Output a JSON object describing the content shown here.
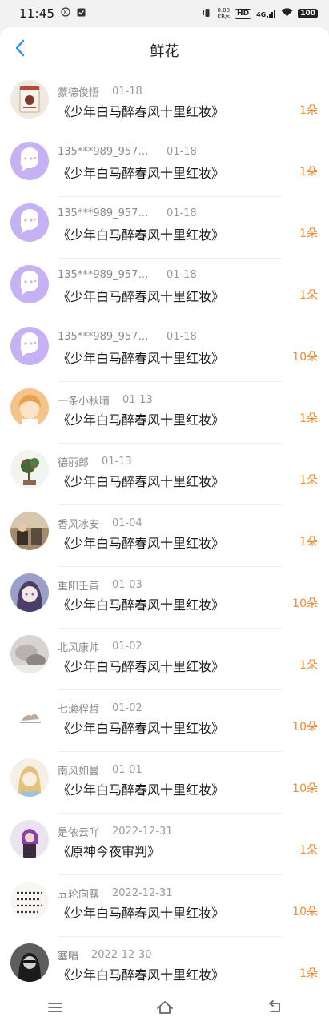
{
  "status_bar": {
    "time": "11:45",
    "icons": [
      "k-icon",
      "clipboard-check-icon"
    ],
    "net_speed_value": "0.00",
    "net_speed_unit": "KB/s",
    "hd_label": "HD",
    "signal_label": "4G",
    "battery": "100"
  },
  "header": {
    "title": "鲜花",
    "back_icon": "chevron-left-icon"
  },
  "colors": {
    "accent_blue": "#2a8fe8",
    "count_orange": "#f08a2c",
    "default_avatar_purple": "#c6b1f5"
  },
  "rows": [
    {
      "user": "蒙德俊悟",
      "date": "01-18",
      "book": "《少年白马醉春风十里红妆》",
      "count": "1朵",
      "avatar": "card"
    },
    {
      "user": "135***989_9579…",
      "date": "01-18",
      "book": "《少年白马醉春风十里红妆》",
      "count": "1朵",
      "avatar": "default"
    },
    {
      "user": "135***989_9579…",
      "date": "01-18",
      "book": "《少年白马醉春风十里红妆》",
      "count": "1朵",
      "avatar": "default"
    },
    {
      "user": "135***989_9579…",
      "date": "01-18",
      "book": "《少年白马醉春风十里红妆》",
      "count": "1朵",
      "avatar": "default"
    },
    {
      "user": "135***989_9579…",
      "date": "01-18",
      "book": "《少年白马醉春风十里红妆》",
      "count": "10朵",
      "avatar": "default"
    },
    {
      "user": "一条小秋晴",
      "date": "01-13",
      "book": "《少年白马醉春风十里红妆》",
      "count": "1朵",
      "avatar": "anime-boy"
    },
    {
      "user": "德丽郎",
      "date": "01-13",
      "book": "《少年白马醉春风十里红妆》",
      "count": "1朵",
      "avatar": "plant"
    },
    {
      "user": "香风冰安",
      "date": "01-04",
      "book": "《少年白马醉春风十里红妆》",
      "count": "1朵",
      "avatar": "photo-room"
    },
    {
      "user": "重阳壬寅",
      "date": "01-03",
      "book": "《少年白马醉春风十里红妆》",
      "count": "10朵",
      "avatar": "anime-girl"
    },
    {
      "user": "北风康帅",
      "date": "01-02",
      "book": "《少年白马醉春风十里红妆》",
      "count": "1朵",
      "avatar": "photo-blur"
    },
    {
      "user": "七濑程哲",
      "date": "01-02",
      "book": "《少年白马醉春风十里红妆》",
      "count": "10朵",
      "avatar": "sketch"
    },
    {
      "user": "南风如曼",
      "date": "01-01",
      "book": "《少年白马醉春风十里红妆》",
      "count": "10朵",
      "avatar": "anime-light"
    },
    {
      "user": "是依云吖",
      "date": "2022-12-31",
      "book": "《原神今夜审判》",
      "count": "1朵",
      "avatar": "person-purple"
    },
    {
      "user": "五轮向露",
      "date": "2022-12-31",
      "book": "《少年白马醉春风十里红妆》",
      "count": "10朵",
      "avatar": "calligraphy"
    },
    {
      "user": "塞唱",
      "date": "2022-12-30",
      "book": "《少年白马醉春风十里红妆》",
      "count": "1朵",
      "avatar": "dark-portrait"
    }
  ],
  "nav": {
    "menu_icon": "menu-icon",
    "home_icon": "home-icon",
    "back_icon": "return-icon"
  }
}
